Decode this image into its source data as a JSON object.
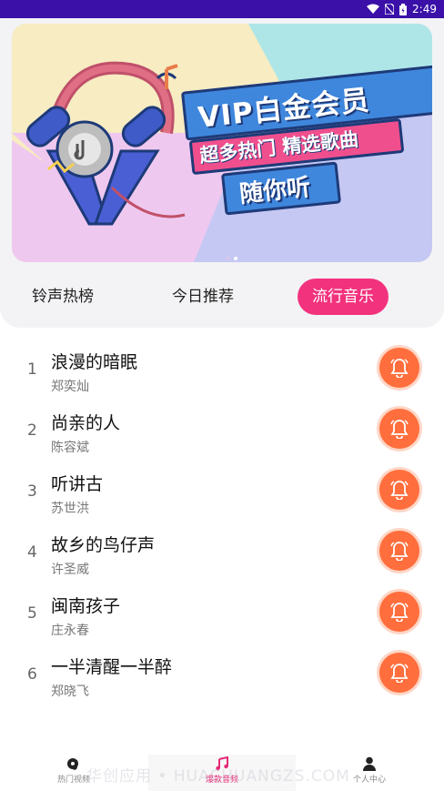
{
  "status_bar": {
    "time": "2:49",
    "background": "#3a10a8"
  },
  "banner": {
    "vip_text": "VIP白金会员",
    "sub_text": "超多热门 精选歌曲",
    "listen_text": "随你听"
  },
  "tabs": [
    {
      "label": "铃声热榜"
    },
    {
      "label": "今日推荐"
    },
    {
      "label": "流行音乐",
      "active": true
    }
  ],
  "songs": [
    {
      "num": "1",
      "title": "浪漫的暗眠",
      "artist": "郑奕灿"
    },
    {
      "num": "2",
      "title": "尚亲的人",
      "artist": "陈容斌"
    },
    {
      "num": "3",
      "title": "听讲古",
      "artist": "苏世洪"
    },
    {
      "num": "4",
      "title": "故乡的鸟仔声",
      "artist": "许圣威"
    },
    {
      "num": "5",
      "title": "闽南孩子",
      "artist": "庄永春"
    },
    {
      "num": "6",
      "title": "一半清醒一半醉",
      "artist": "郑晓飞"
    }
  ],
  "bottom_nav": [
    {
      "label": "热门视频",
      "icon": "video-music-icon"
    },
    {
      "label": "爆款音频",
      "icon": "music-note-icon",
      "active": true
    },
    {
      "label": "个人中心",
      "icon": "person-icon"
    }
  ],
  "watermark": "华创应用 • HUACHUANGZS.COM",
  "colors": {
    "accent_pink": "#f2327d",
    "bell_orange": "#ff6e3c"
  }
}
